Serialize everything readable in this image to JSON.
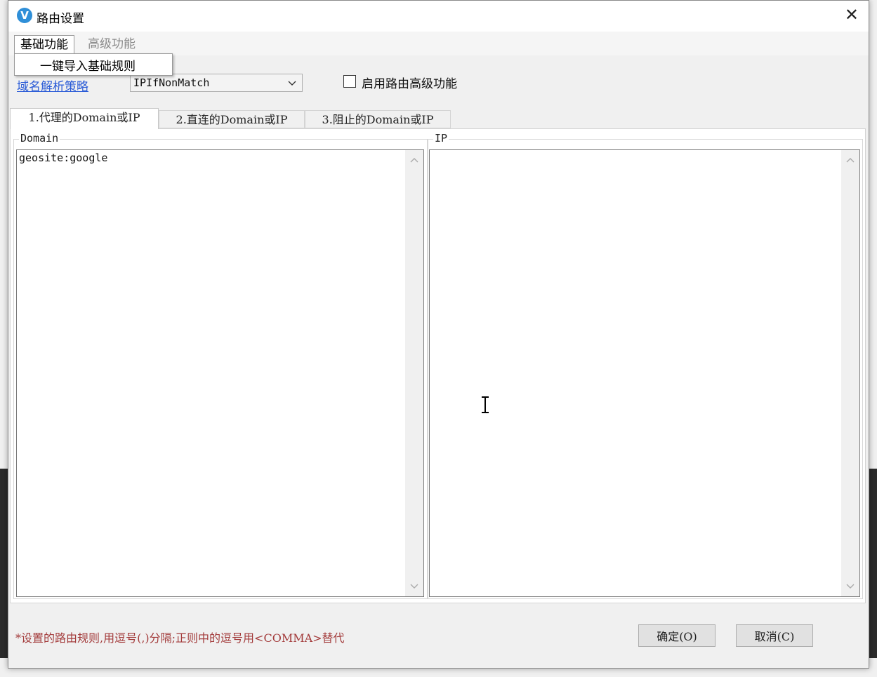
{
  "window": {
    "title": "路由设置",
    "logo_letter": "V"
  },
  "menu": {
    "items": [
      {
        "label": "基础功能"
      },
      {
        "label": "高级功能"
      }
    ],
    "dropdown": {
      "items": [
        {
          "label": "一键导入基础规则"
        }
      ]
    }
  },
  "toolbar": {
    "domain_strategy_label": "域名解析策略",
    "domain_strategy_value": "IPIfNonMatch",
    "advanced_checkbox_label": "启用路由高级功能",
    "advanced_checked": false
  },
  "tabs": [
    {
      "label": "1.代理的Domain或IP",
      "active": true
    },
    {
      "label": "2.直连的Domain或IP",
      "active": false
    },
    {
      "label": "3.阻止的Domain或IP",
      "active": false
    }
  ],
  "panel": {
    "domain_label": "Domain",
    "domain_value": "geosite:google",
    "ip_label": "IP",
    "ip_value": ""
  },
  "footer": {
    "note": "*设置的路由规则,用逗号(,)分隔;正则中的逗号用<COMMA>替代",
    "ok_label": "确定(O)",
    "cancel_label": "取消(C)"
  },
  "colors": {
    "accent_link": "#2a5bd7",
    "note": "#a33b3b",
    "logo": "#2f8fd8"
  }
}
